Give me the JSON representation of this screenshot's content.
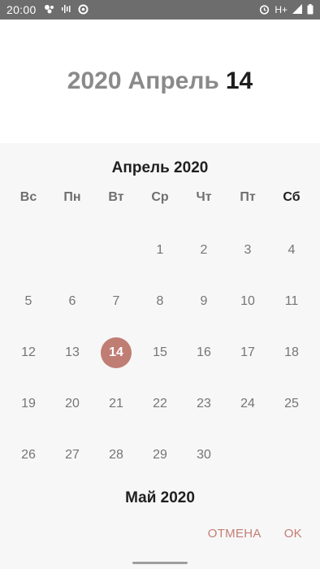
{
  "status_bar": {
    "time": "20:00",
    "network": "H+",
    "left_icons": [
      "bubbles-icon",
      "voicemail-wave-icon",
      "sync-icon"
    ],
    "right_icons": [
      "alarm-icon",
      "signal-icon",
      "battery-icon"
    ]
  },
  "header": {
    "year": "2020",
    "month": "Апрель",
    "day": "14"
  },
  "calendar": {
    "current_month_title": "Апрель 2020",
    "next_month_title": "Май 2020",
    "weekdays": [
      "Вс",
      "Пн",
      "Вт",
      "Ср",
      "Чт",
      "Пт",
      "Сб"
    ],
    "days": [
      "",
      "",
      "",
      "1",
      "2",
      "3",
      "4",
      "5",
      "6",
      "7",
      "8",
      "9",
      "10",
      "11",
      "12",
      "13",
      "14",
      "15",
      "16",
      "17",
      "18",
      "19",
      "20",
      "21",
      "22",
      "23",
      "24",
      "25",
      "26",
      "27",
      "28",
      "29",
      "30",
      "",
      ""
    ],
    "selected_day": "14"
  },
  "actions": {
    "cancel": "ОТМЕНА",
    "ok": "OK"
  },
  "colors": {
    "accent": "#c07d73",
    "status_bar": "#6d6d6d"
  }
}
